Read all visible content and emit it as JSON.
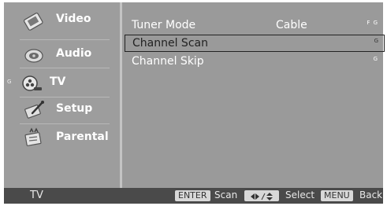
{
  "sidebar": {
    "items": [
      {
        "label": "Video",
        "icon": "video-icon"
      },
      {
        "label": "Audio",
        "icon": "audio-icon"
      },
      {
        "label": "TV",
        "icon": "tv-icon",
        "marker": "G"
      },
      {
        "label": "Setup",
        "icon": "setup-icon"
      },
      {
        "label": "Parental",
        "icon": "parental-icon"
      }
    ]
  },
  "options": [
    {
      "label": "Tuner Mode",
      "value": "Cable",
      "marker": "F G"
    },
    {
      "label": "Channel Scan",
      "value": "",
      "marker": "G"
    },
    {
      "label": "Channel Skip",
      "value": "",
      "marker": "G"
    }
  ],
  "footer": {
    "title": "TV",
    "enter_key": "ENTER",
    "enter_action": "Scan",
    "select_action": "Select",
    "menu_key": "MENU",
    "menu_action": "Back"
  },
  "colors": {
    "panel": "#9a9a9a",
    "bottom_bar": "#4a4a4a",
    "text": "#ffffff"
  }
}
